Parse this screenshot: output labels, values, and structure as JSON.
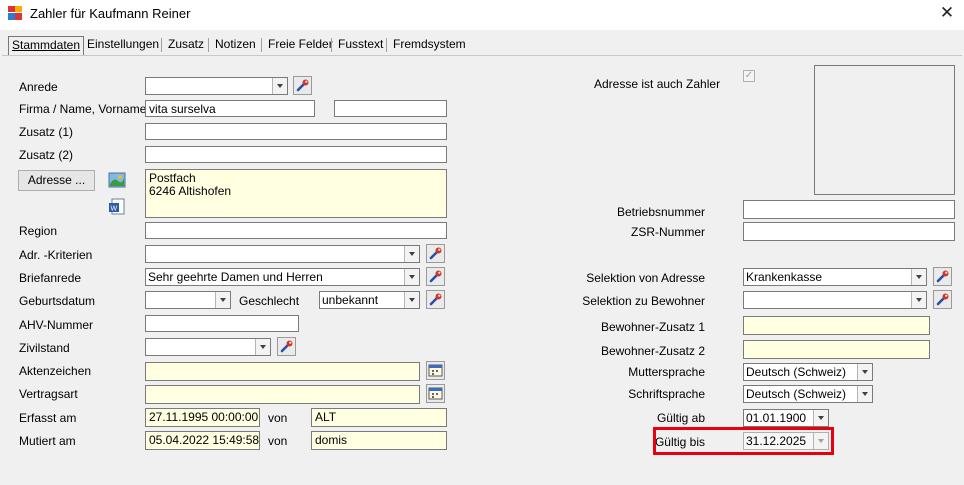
{
  "window": {
    "title": "Zahler für Kaufmann Reiner",
    "close_glyph": "✕"
  },
  "tabs": [
    {
      "label": "Stammdaten",
      "active": true
    },
    {
      "label": "Einstellungen"
    },
    {
      "label": "Zusatz"
    },
    {
      "label": "Notizen"
    },
    {
      "label": "Freie Felder"
    },
    {
      "label": "Fusstext"
    },
    {
      "label": "Fremdsystem"
    }
  ],
  "left": {
    "anrede": {
      "label": "Anrede",
      "value": ""
    },
    "firma": {
      "label": "Firma / Name, Vorname",
      "value1": "vita surselva",
      "value2": ""
    },
    "zusatz1": {
      "label": "Zusatz (1)",
      "value": ""
    },
    "zusatz2": {
      "label": "Zusatz (2)",
      "value": ""
    },
    "adresse": {
      "button_label": "Adresse ...",
      "text": "Postfach\n6246 Altishofen"
    },
    "region": {
      "label": "Region",
      "value": ""
    },
    "adr_kriterien": {
      "label": "Adr. -Kriterien",
      "value": ""
    },
    "briefanrede": {
      "label": "Briefanrede",
      "value": "Sehr geehrte Damen und Herren"
    },
    "geburtsdatum": {
      "label": "Geburtsdatum",
      "value": ""
    },
    "geschlecht": {
      "label": "Geschlecht",
      "value": "unbekannt"
    },
    "ahv": {
      "label": "AHV-Nummer",
      "value": ""
    },
    "zivilstand": {
      "label": "Zivilstand",
      "value": ""
    },
    "aktenzeichen": {
      "label": "Aktenzeichen",
      "value": ""
    },
    "vertragsart": {
      "label": "Vertragsart",
      "value": ""
    },
    "erfasst": {
      "label": "Erfasst am",
      "date": "27.11.1995 00:00:00",
      "von_label": "von",
      "user": "ALT"
    },
    "mutiert": {
      "label": "Mutiert am",
      "date": "05.04.2022 15:49:58",
      "von_label": "von",
      "user": "domis"
    }
  },
  "right": {
    "adresse_zahler": {
      "label": "Adresse ist auch Zahler",
      "checked": true
    },
    "betriebsnummer": {
      "label": "Betriebsnummer",
      "value": ""
    },
    "zsr": {
      "label": "ZSR-Nummer",
      "value": ""
    },
    "sel_adresse": {
      "label": "Selektion von Adresse",
      "value": "Krankenkasse"
    },
    "sel_bewohner": {
      "label": "Selektion zu Bewohner",
      "value": ""
    },
    "bew_zusatz1": {
      "label": "Bewohner-Zusatz 1",
      "value": ""
    },
    "bew_zusatz2": {
      "label": "Bewohner-Zusatz 2",
      "value": ""
    },
    "muttersprache": {
      "label": "Muttersprache",
      "value": "Deutsch (Schweiz)"
    },
    "schriftsprache": {
      "label": "Schriftsprache",
      "value": "Deutsch (Schweiz)"
    },
    "gueltig_ab": {
      "label": "Gültig ab",
      "value": "01.01.1900"
    },
    "gueltig_bis": {
      "label": "Gültig bis",
      "value": "31.12.2025"
    }
  },
  "colors": {
    "highlight": "#e8000e",
    "yellow_field": "#ffffe1"
  }
}
